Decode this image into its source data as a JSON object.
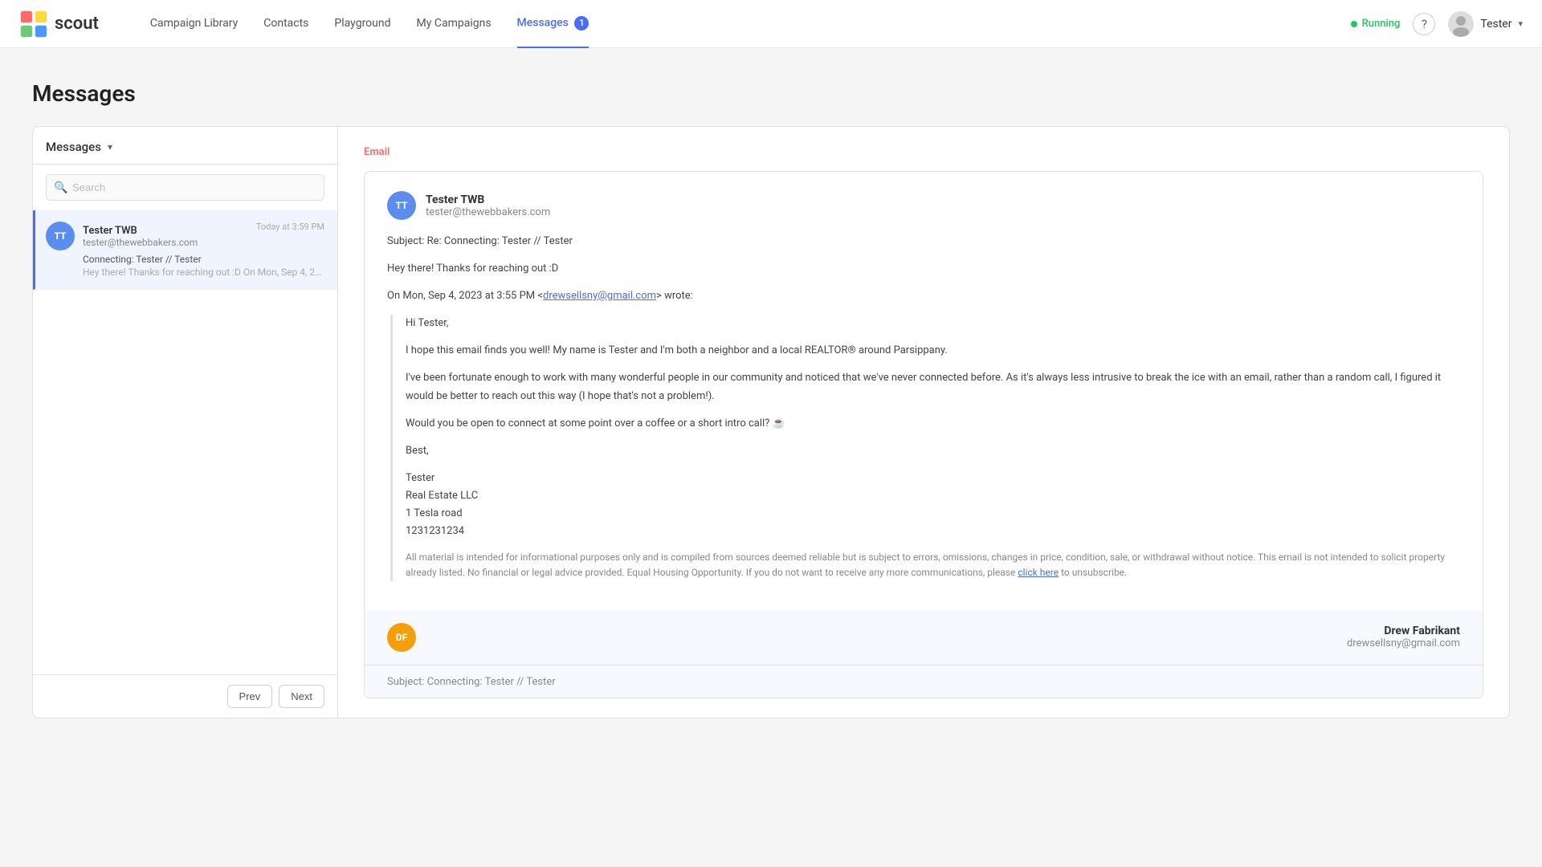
{
  "app": {
    "logo_text": "scout",
    "status": "Running"
  },
  "nav": {
    "links": [
      {
        "id": "campaign-library",
        "label": "Campaign Library",
        "active": false
      },
      {
        "id": "contacts",
        "label": "Contacts",
        "active": false
      },
      {
        "id": "playground",
        "label": "Playground",
        "active": false
      },
      {
        "id": "my-campaigns",
        "label": "My Campaigns",
        "active": false
      },
      {
        "id": "messages",
        "label": "Messages",
        "active": true,
        "badge": "1"
      }
    ],
    "user": {
      "name": "Tester"
    }
  },
  "sidebar": {
    "dropdown_label": "Messages",
    "search_placeholder": "Search",
    "messages": [
      {
        "id": "tester-twb",
        "avatar_initials": "TT",
        "avatar_color": "#5b8dee",
        "sender": "Tester TWB",
        "email": "tester@thewebbakers.com",
        "time": "Today at 3:59 PM",
        "subject": "Connecting: Tester // Tester",
        "preview": "Hey there! Thanks for reaching out :D On Mon, Sep 4, 2023 at 3:55 PM <dr...",
        "selected": true
      }
    ],
    "prev_label": "Prev",
    "next_label": "Next"
  },
  "email_panel": {
    "type_label": "Email",
    "thread": [
      {
        "id": "reply",
        "avatar_initials": "TT",
        "avatar_color": "#5b8dee",
        "sender_name": "Tester TWB",
        "sender_email": "tester@thewebbakers.com",
        "subject": "Subject: Re: Connecting: Tester // Tester",
        "body_greeting": "Hey there! Thanks for reaching out :D",
        "body_on_date": "On Mon, Sep 4, 2023 at 3:55 PM <",
        "body_link": "drewsellsny@gmail.com",
        "body_after_link": "> wrote:",
        "original_greeting": "Hi Tester,",
        "original_p1": "I hope this email finds you well! My name is Tester and I'm both a neighbor and a local REALTOR® around Parsippany.",
        "original_p2": "I've been fortunate enough to work with many wonderful people in our community and noticed that we've never connected before. As it's always less intrusive to break the ice with an email, rather than a random call, I figured it would be better to reach out this way (I hope that's not a problem!).",
        "original_p3": "Would you be open to connect at some point over a coffee or a short intro call? ☕",
        "original_sign_best": "Best,",
        "original_sign_name": "Tester",
        "original_sign_company": "Real Estate LLC",
        "original_sign_address": "1 Tesla road",
        "original_sign_phone": "1231231234",
        "original_disclaimer": "All material is intended for informational purposes only and is compiled from sources deemed reliable but is subject to errors, omissions, changes in price, condition, sale, or withdrawal without notice. This email is not intended to solicit property already listed. No financial or legal advice provided. Equal Housing Opportunity. If you do not want to receive any more communications, please",
        "original_unsubscribe_text": "click here",
        "original_unsubscribe_after": " to unsubscribe."
      },
      {
        "id": "original",
        "avatar_initials": "DF",
        "avatar_color": "#f59e0b",
        "sender_name": "Drew Fabrikant",
        "sender_email": "drewsellsny@gmail.com",
        "collapsed_subject": "Subject: Connecting: Tester // Tester"
      }
    ]
  }
}
